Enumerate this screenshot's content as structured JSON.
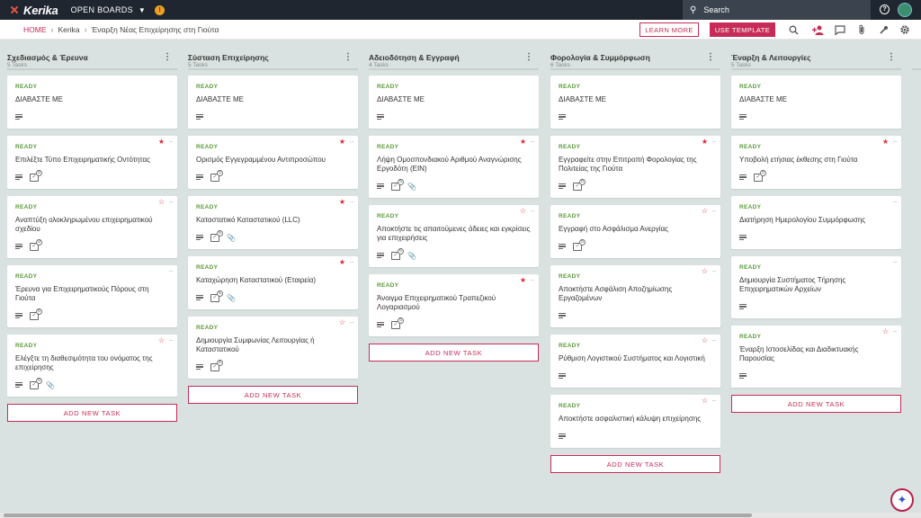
{
  "topbar": {
    "logo_text": "Kerika",
    "boards_menu_label": "OPEN BOARDS",
    "notification_glyph": "!",
    "search_placeholder": "Search",
    "help_glyph": "?"
  },
  "header": {
    "breadcrumb": {
      "home": "HOME",
      "org": "Kerika",
      "board": "Έναρξη Νέας Επιχείρησης στη Γιούτα"
    },
    "learn_more_label": "LEARN MORE",
    "use_template_label": "USE TEMPLATE",
    "icons": [
      "search-icon",
      "add-person-icon",
      "chat-icon",
      "attachment-icon",
      "tools-icon",
      "gear-icon"
    ]
  },
  "colors": {
    "brand": "#c62c57",
    "ready": "#5a9a3a",
    "star": "#e0283a",
    "topbar": "#1f2630",
    "board_bg": "#d9e2e0"
  },
  "columns": [
    {
      "title": "Σχεδιασμός & Έρευνα",
      "count": "5 Tasks",
      "cards": [
        {
          "status": "READY",
          "title": "ΔΙΑΒΑΣΤΕ ΜΕ",
          "star": "none",
          "desc": true,
          "check": false,
          "check_count": "",
          "attach": false
        },
        {
          "status": "READY",
          "title": "Επιλέξτε Τύπο Επιχειρηματικής Οντότητας",
          "star": "filled",
          "desc": true,
          "check": true,
          "check_count": "5",
          "attach": false
        },
        {
          "status": "READY",
          "title": "Αναπτύξη ολοκληρωμένου επιχειρηματικού σχεδίου",
          "star": "outline",
          "desc": true,
          "check": true,
          "check_count": "9",
          "attach": false
        },
        {
          "status": "READY",
          "title": "Έρευνα για Επιχειρηματικούς Πόρους στη Γιούτα",
          "star": "none",
          "desc": true,
          "check": true,
          "check_count": "6",
          "attach": false
        },
        {
          "status": "READY",
          "title": "Ελέγξτε τη διαθεσιμότητα του ονόματος της επιχείρησης",
          "star": "outline",
          "desc": true,
          "check": true,
          "check_count": "5",
          "attach": true
        }
      ],
      "add_label": "ADD NEW TASK"
    },
    {
      "title": "Σύσταση Επιχείρησης",
      "count": "5 Tasks",
      "cards": [
        {
          "status": "READY",
          "title": "ΔΙΑΒΑΣΤΕ ΜΕ",
          "star": "none",
          "desc": true,
          "check": false,
          "check_count": "",
          "attach": false
        },
        {
          "status": "READY",
          "title": "Ορισμός Εγγεγραμμένου Αντιπροσώπου",
          "star": "filled",
          "desc": true,
          "check": true,
          "check_count": "5",
          "attach": false
        },
        {
          "status": "READY",
          "title": "Καταστατικό Καταστατικού (LLC)",
          "star": "filled",
          "desc": true,
          "check": true,
          "check_count": "6",
          "attach": true
        },
        {
          "status": "READY",
          "title": "Καταχώρηση Καταστατικού (Εταιρεία)",
          "star": "filled",
          "desc": true,
          "check": true,
          "check_count": "6",
          "attach": true
        },
        {
          "status": "READY",
          "title": "Δημιουργία Συμφωνίας Λειτουργίας ή Καταστατικού",
          "star": "outline",
          "desc": true,
          "check": true,
          "check_count": "8",
          "attach": false
        }
      ],
      "add_label": "ADD NEW TASK"
    },
    {
      "title": "Αδειοδότηση & Εγγραφή",
      "count": "4 Tasks",
      "cards": [
        {
          "status": "READY",
          "title": "ΔΙΑΒΑΣΤΕ ΜΕ",
          "star": "none",
          "desc": true,
          "check": false,
          "check_count": "",
          "attach": false
        },
        {
          "status": "READY",
          "title": "Λήψη Ομοσπονδιακού Αριθμού Αναγνώρισης Εργοδότη (EIN)",
          "star": "filled",
          "desc": true,
          "check": true,
          "check_count": "5",
          "attach": true
        },
        {
          "status": "READY",
          "title": "Αποκτήστε τις απαιτούμενες άδειες και εγκρίσεις για επιχειρήσεις",
          "star": "outline",
          "desc": true,
          "check": true,
          "check_count": "6",
          "attach": true
        },
        {
          "status": "READY",
          "title": "Άνοιγμα Επιχειρηματικού Τραπεζικού Λογαριασμού",
          "star": "filled",
          "desc": true,
          "check": true,
          "check_count": "5",
          "attach": false
        }
      ],
      "add_label": "ADD NEW TASK"
    },
    {
      "title": "Φορολογία & Συμμόρφωση",
      "count": "6 Tasks",
      "cards": [
        {
          "status": "READY",
          "title": "ΔΙΑΒΑΣΤΕ ΜΕ",
          "star": "none",
          "desc": true,
          "check": false,
          "check_count": "",
          "attach": false
        },
        {
          "status": "READY",
          "title": "Εγγραφείτε στην Επιτροπή Φορολογίας της Πολιτείας της Γιούτα",
          "star": "filled",
          "desc": true,
          "check": true,
          "check_count": "5",
          "attach": false
        },
        {
          "status": "READY",
          "title": "Εγγραφή στο Ασφάλισμα Ανεργίας",
          "star": "outline",
          "desc": true,
          "check": true,
          "check_count": "5",
          "attach": false
        },
        {
          "status": "READY",
          "title": "Αποκτήστε Ασφάλιση Αποζημίωσης Εργαζομένων",
          "star": "outline",
          "desc": true,
          "check": false,
          "check_count": "",
          "attach": false
        },
        {
          "status": "READY",
          "title": "Ρύθμιση Λογιστικού Συστήματος και Λογιστική",
          "star": "outline",
          "desc": true,
          "check": false,
          "check_count": "",
          "attach": false
        },
        {
          "status": "READY",
          "title": "Αποκτήστε ασφαλιστική κάλυψη επιχείρησης",
          "star": "outline",
          "desc": true,
          "check": false,
          "check_count": "",
          "attach": false
        }
      ],
      "add_label": "ADD NEW TASK"
    },
    {
      "title": "Έναρξη & Λειτουργίες",
      "count": "5 Tasks",
      "cards": [
        {
          "status": "READY",
          "title": "ΔΙΑΒΑΣΤΕ ΜΕ",
          "star": "none",
          "desc": true,
          "check": false,
          "check_count": "",
          "attach": false
        },
        {
          "status": "READY",
          "title": "Υποβολή ετήσιας έκθεσης στη Γιούτα",
          "star": "filled",
          "desc": true,
          "check": true,
          "check_count": "5",
          "attach": false
        },
        {
          "status": "READY",
          "title": "Διατήρηση Ημερολογίου Συμμόρφωσης",
          "star": "none",
          "desc": true,
          "check": false,
          "check_count": "",
          "attach": false
        },
        {
          "status": "READY",
          "title": "Δημιουργία Συστήματος Τήρησης Επιχειρηματικών Αρχείων",
          "star": "none",
          "desc": true,
          "check": false,
          "check_count": "",
          "attach": false
        },
        {
          "status": "READY",
          "title": "Έναρξη Ιστοσελίδας και Διαδικτυακής Παρουσίας",
          "star": "outline",
          "desc": true,
          "check": false,
          "check_count": "",
          "attach": false
        }
      ],
      "add_label": "ADD NEW TASK"
    }
  ]
}
